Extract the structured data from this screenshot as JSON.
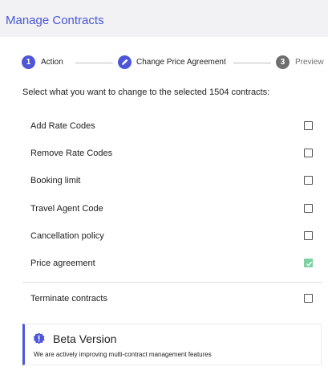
{
  "header": {
    "title": "Manage Contracts"
  },
  "stepper": {
    "steps": [
      {
        "number": "1",
        "label": "Action",
        "state": "active"
      },
      {
        "number": "",
        "label": "Change Price Agreement",
        "state": "edit"
      },
      {
        "number": "3",
        "label": "Preview",
        "state": "todo"
      }
    ]
  },
  "instruction": "Select what you want to change to the selected 1504 contracts:",
  "options": [
    {
      "label": "Add Rate Codes",
      "checked": false
    },
    {
      "label": "Remove Rate Codes",
      "checked": false
    },
    {
      "label": "Booking limit",
      "checked": false
    },
    {
      "label": "Travel Agent Code",
      "checked": false
    },
    {
      "label": "Cancellation policy",
      "checked": false
    },
    {
      "label": "Price agreement",
      "checked": true
    }
  ],
  "terminate": {
    "label": "Terminate contracts",
    "checked": false
  },
  "beta": {
    "title": "Beta Version",
    "description": "We are actively improving multi-contract management features",
    "icon": "badge-alert-icon"
  },
  "colors": {
    "accent": "#4d56d8",
    "checked": "#7fd1a5",
    "header_bg": "#f2f2f4",
    "title": "#4856d6"
  }
}
